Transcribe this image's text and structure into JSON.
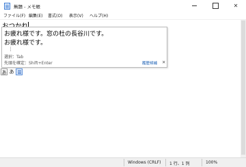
{
  "window": {
    "title": "無題 - メモ帳",
    "minimize_label": "",
    "maximize_label": "",
    "close_label": "✕"
  },
  "menu": {
    "items": [
      {
        "label": "ファイル(F)"
      },
      {
        "label": "編集(E)"
      },
      {
        "label": "書式(O)"
      },
      {
        "label": "表示(V)"
      },
      {
        "label": "ヘルプ(H)"
      }
    ]
  },
  "editor": {
    "composition_text": "おつかれ"
  },
  "ime_popup": {
    "candidates": [
      {
        "text": "お疲れ様です。窓の杜の長谷川です。"
      },
      {
        "text": "お疲れ様です。"
      }
    ],
    "more_indicator": "︙",
    "hint_select": "選択：Tab",
    "hint_confirm": "先頭を確定：Shift+Enter",
    "history_label": "履歴候補",
    "close_label": "✕"
  },
  "ime_toolbar": {
    "hiragana_label": "あ",
    "mode_label": "あ",
    "icon_names": [
      "hiragana-mode-icon",
      "input-mode-icon",
      "ime-menu-icon"
    ]
  },
  "status": {
    "line_ending": "Windows (CRLF)",
    "position": "1 行、1 列",
    "zoom": "100%"
  }
}
